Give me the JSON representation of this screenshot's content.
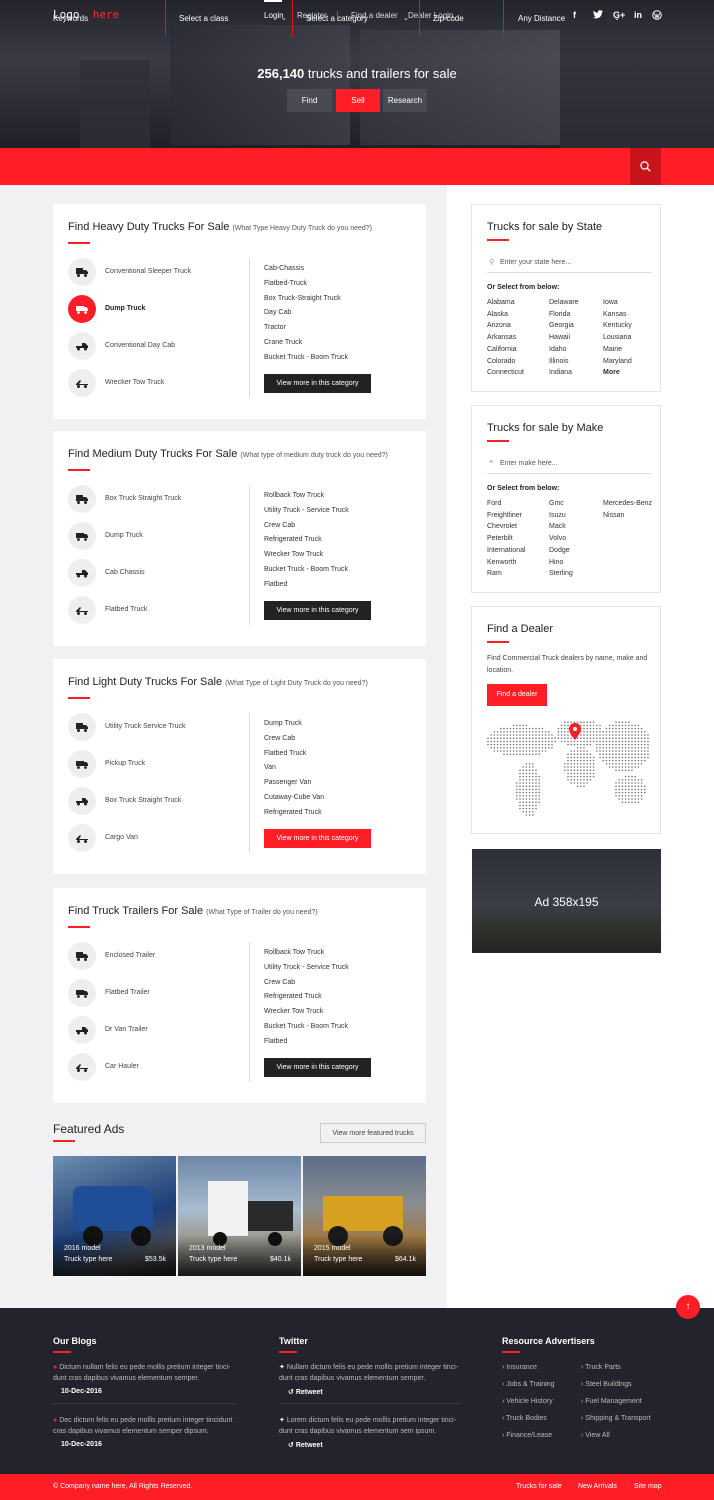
{
  "header": {
    "logo": {
      "word": "Logo",
      "accent": "here"
    },
    "nav": [
      {
        "label": "Login",
        "active": true
      },
      {
        "label": "Register"
      },
      {
        "label": "Find a dealer"
      },
      {
        "label": "Dealer Login"
      }
    ],
    "social": [
      "facebook-icon",
      "twitter-icon",
      "google-plus-icon",
      "linkedin-icon",
      "wordpress-icon"
    ]
  },
  "hero": {
    "count": "256,140",
    "title_rest": "trucks and trailers for sale",
    "buttons": [
      "Find",
      "Sell",
      "Research"
    ]
  },
  "search": {
    "keywords": "Keywords",
    "class": "Select a class",
    "category": "Select a category",
    "zip": "Zip code",
    "distance": "Any Distance"
  },
  "sections": [
    {
      "title": "Find Heavy Duty Trucks For Sale",
      "subtitle": "(What Type Heavy Duty Truck do you need?)",
      "categories": [
        "Conventional Sleeper Truck",
        "Dump Truck",
        "Conventional Day Cab",
        "Wrecker Tow Truck"
      ],
      "links": [
        "Cab-Chassis",
        "Flatbed-Truck",
        "Box Truck-Straight Truck",
        "Day Cab",
        "Tractor",
        "Crane Truck",
        "Bucket Truck - Boom Truck"
      ],
      "button": "View more in this category"
    },
    {
      "title": "Find Medium Duty Trucks For Sale",
      "subtitle": "(What type of medium duty truck do you need?)",
      "categories": [
        "Box Truck Straight Truck",
        "Dump Truck",
        "Cab Chassis",
        "Flatbed Truck"
      ],
      "links": [
        "Rollback Tow Truck",
        "Utility Truck - Service Truck",
        "Crew Cab",
        "Refrigerated Truck",
        "Wrecker Tow Truck",
        "Bucket Truck - Boom Truck",
        "Flatbed"
      ],
      "button": "View more in this category"
    },
    {
      "title": "Find Light Duty Trucks For Sale",
      "subtitle": "(What Type of Light Duty Truck do you need?)",
      "categories": [
        "Utility Truck Service Truck",
        "Pickup Truck",
        "Box Truck Straight Truck",
        "Cargo Van"
      ],
      "links": [
        "Dump Truck",
        "Crew Cab",
        "Flatbed Truck",
        "Van",
        "Passenger Van",
        "Cutaway-Cube Van",
        "Refrigerated Truck"
      ],
      "button": "View more in this category"
    },
    {
      "title": "Find Truck Trailers For Sale",
      "subtitle": "(What Type of Trailer do you need?)",
      "categories": [
        "Enclosed Trailer",
        "Flatbed Trailer",
        "Dr Van Trailer",
        "Car Hauler"
      ],
      "links": [
        "Rollback Tow Truck",
        "Utility Truck - Service Truck",
        "Crew Cab",
        "Refrigerated Truck",
        "Wrecker Tow Truck",
        "Bucket Truck - Boom Truck",
        "Flatbed"
      ],
      "button": "View more in this category"
    }
  ],
  "by_state": {
    "title": "Trucks for sale by State",
    "placeholder": "Enter your state here...",
    "or_select": "Or Select from below:",
    "col1": [
      "Alabama",
      "Alaska",
      "Arizona",
      "Arkansas",
      "California",
      "Colorado",
      "Connecticut"
    ],
    "col2": [
      "Delaware",
      "Florida",
      "Georgia",
      "Hawaii",
      "Idaho",
      "Illinois",
      "Indiana"
    ],
    "col3": [
      "Iowa",
      "Kansas",
      "Kentucky",
      "Lousiana",
      "Maine",
      "Maryland"
    ],
    "more": "More"
  },
  "by_make": {
    "title": "Trucks for sale by Make",
    "placeholder": "Enter make here...",
    "or_select": "Or Select from below:",
    "col1": [
      "Ford",
      "Freightliner",
      "Chevrolet",
      "Peterbilt",
      "International",
      "Kenworth",
      "Ram"
    ],
    "col2": [
      "Gmc",
      "Isuzu",
      "Mack",
      "Volvo",
      "Dodge",
      "Hino",
      "Sterling"
    ],
    "col3": [
      "Mercedes-Benz",
      "Nissan"
    ]
  },
  "dealer": {
    "title": "Find a Dealer",
    "text": "Find Commercial Truck dealers by name, make and location.",
    "button": "Find a dealer"
  },
  "ad": {
    "label": "Ad 358x195"
  },
  "featured": {
    "title": "Featured Ads",
    "button": "View more featured trucks",
    "items": [
      {
        "model": "2016 model",
        "type": "Truck type here",
        "price": "$53.5k"
      },
      {
        "model": "2013 model",
        "type": "Truck type here",
        "price": "$40.1k"
      },
      {
        "model": "2015 model",
        "type": "Truck type here",
        "price": "$64.1k"
      }
    ]
  },
  "footer": {
    "blogs_title": "Our Blogs",
    "blogs": [
      {
        "text": "Dictum nullam felis eu pede mollis pretium integer tinci-dunt cras dapibus vivamus elementum semper.",
        "date": "10-Dec-2016"
      },
      {
        "text": "Dec dictum felis eu pede mollis pretium integer tincidunt cras dapibus vivamus elementum semper dipsum.",
        "date": "10-Dec-2016"
      }
    ],
    "twitter_title": "Twitter",
    "tweets": [
      {
        "text": "Nullam dictum felis eu pede mollis pretium integer tinci-dunt cras dapibus vivamus elementum semper.",
        "action": "Retweet"
      },
      {
        "text": "Lorem dictum felis eu pede mollis pretium integer tinci-dunt cras dapibus vivamus elementum sem ipsum.",
        "action": "Retweet"
      }
    ],
    "resources_title": "Resource Advertisers",
    "resources_col1": [
      "Insurance",
      "Jobs & Training",
      "Vehicle History",
      "Truck Bodies",
      "Finance/Lease"
    ],
    "resources_col2": [
      "Truck Parts",
      "Steel Buildings",
      "Fuel Management",
      "Shipping & Transport",
      "View All"
    ]
  },
  "bottom": {
    "copyright": "© Company name here, All Rights Reserved.",
    "links": [
      "Trucks for sale",
      "New Arrivals",
      "Site map"
    ]
  },
  "colors": {
    "accent": "#ff1e26",
    "dark": "#22232c",
    "page_bg": "#f1f1f4"
  }
}
